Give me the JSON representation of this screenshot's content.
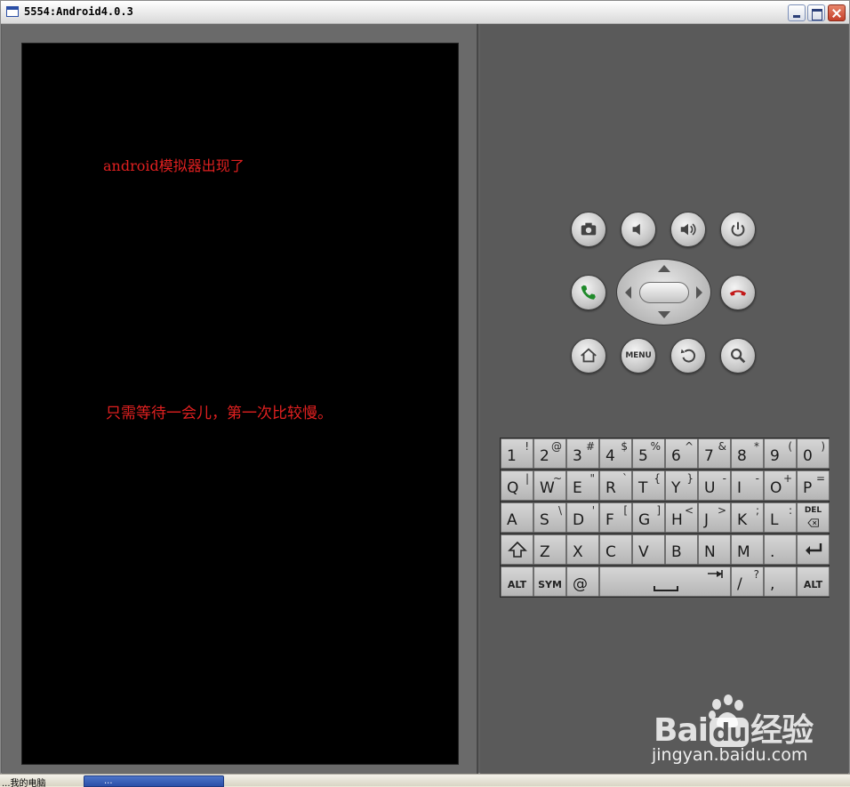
{
  "window": {
    "title": "5554:Android4.0.3"
  },
  "screen": {
    "line1": "android模拟器出现了",
    "line2": "只需等待一会儿，第一次比较慢。"
  },
  "controls": {
    "camera": "camera-icon",
    "volume_down": "volume-down-icon",
    "volume_up": "volume-up-icon",
    "power": "power-icon",
    "call": "call-icon",
    "end_call": "end-call-icon",
    "home": "home-icon",
    "menu_label": "MENU",
    "back": "back-icon",
    "search": "search-icon"
  },
  "colors": {
    "caption": "#e02020",
    "call_green": "#1f8a2a",
    "end_red": "#c21818"
  },
  "keyboard": {
    "row1": [
      {
        "main": "1",
        "alt": "!"
      },
      {
        "main": "2",
        "alt": "@"
      },
      {
        "main": "3",
        "alt": "#"
      },
      {
        "main": "4",
        "alt": "$"
      },
      {
        "main": "5",
        "alt": "%"
      },
      {
        "main": "6",
        "alt": "^"
      },
      {
        "main": "7",
        "alt": "&"
      },
      {
        "main": "8",
        "alt": "*"
      },
      {
        "main": "9",
        "alt": "("
      },
      {
        "main": "0",
        "alt": ")"
      }
    ],
    "row2": [
      {
        "main": "Q",
        "alt": "|"
      },
      {
        "main": "W",
        "alt": "~"
      },
      {
        "main": "E",
        "alt": "\""
      },
      {
        "main": "R",
        "alt": "`"
      },
      {
        "main": "T",
        "alt": "{"
      },
      {
        "main": "Y",
        "alt": "}"
      },
      {
        "main": "U",
        "alt": "-"
      },
      {
        "main": "I",
        "alt": "-"
      },
      {
        "main": "O",
        "alt": "+"
      },
      {
        "main": "P",
        "alt": "="
      }
    ],
    "row3": [
      {
        "main": "A",
        "alt": ""
      },
      {
        "main": "S",
        "alt": "\\"
      },
      {
        "main": "D",
        "alt": "'"
      },
      {
        "main": "F",
        "alt": "["
      },
      {
        "main": "G",
        "alt": "]"
      },
      {
        "main": "H",
        "alt": "<"
      },
      {
        "main": "J",
        "alt": ">"
      },
      {
        "main": "K",
        "alt": ";"
      },
      {
        "main": "L",
        "alt": ":"
      }
    ],
    "row3_del": "DEL",
    "row4": [
      {
        "main": "Z",
        "alt": ""
      },
      {
        "main": "X",
        "alt": ""
      },
      {
        "main": "C",
        "alt": ""
      },
      {
        "main": "V",
        "alt": ""
      },
      {
        "main": "B",
        "alt": ""
      },
      {
        "main": "N",
        "alt": ""
      },
      {
        "main": "M",
        "alt": ""
      },
      {
        "main": ".",
        "alt": ""
      }
    ],
    "row5": {
      "alt_left": "ALT",
      "sym": "SYM",
      "at": "@",
      "slash": "/",
      "slash_alt": "?",
      "comma": ",",
      "alt_right": "ALT"
    }
  },
  "watermark": {
    "brand_a": "Bai",
    "brand_b": "du",
    "brand_c": "经验",
    "url": "jingyan.baidu.com"
  },
  "taskbar": {
    "item_a": "...我的电脑",
    "item_b": "..."
  }
}
